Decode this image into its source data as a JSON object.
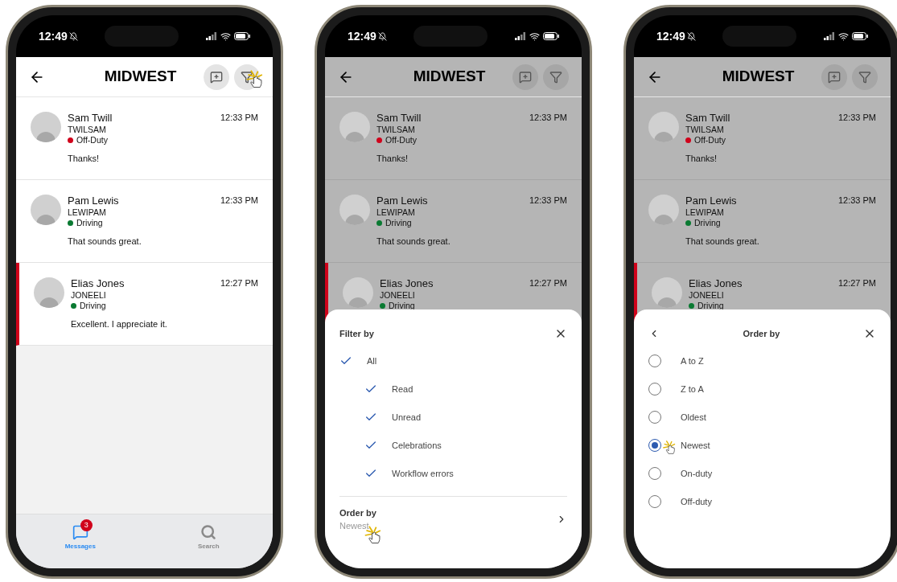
{
  "phones": [
    {
      "status_time": "12:49",
      "title": "MIDWEST",
      "dimmed": false,
      "header_buttons": [
        {
          "kind": "new-message",
          "tap": false
        },
        {
          "kind": "filter",
          "tap": true
        }
      ],
      "messages": [
        {
          "name": "Sam Twill",
          "user_id": "TWILSAM",
          "status": "Off-Duty",
          "color": "#d0021b",
          "text": "Thanks!",
          "time": "12:33 PM",
          "flagged": false
        },
        {
          "name": "Pam Lewis",
          "user_id": "LEWIPAM",
          "status": "Driving",
          "color": "#0a7a32",
          "text": "That sounds great.",
          "time": "12:33 PM",
          "flagged": false
        },
        {
          "name": "Elias Jones",
          "user_id": "JONEELI",
          "status": "Driving",
          "color": "#0a7a32",
          "text": "Excellent. I appreciate it.",
          "time": "12:27 PM",
          "flagged": true
        }
      ],
      "tab_bar": [
        {
          "kind": "messages",
          "label": "Messages",
          "selected": true,
          "badge": "3"
        },
        {
          "kind": "search",
          "label": "Search",
          "selected": false
        }
      ]
    },
    {
      "status_time": "12:49",
      "title": "MIDWEST",
      "dimmed": true,
      "header_buttons": [
        {
          "kind": "new-message",
          "tap": false
        },
        {
          "kind": "filter",
          "tap": false
        }
      ],
      "messages": [
        {
          "name": "Sam Twill",
          "user_id": "TWILSAM",
          "status": "Off-Duty",
          "color": "#d0021b",
          "text": "Thanks!",
          "time": "12:33 PM",
          "flagged": false
        },
        {
          "name": "Pam Lewis",
          "user_id": "LEWIPAM",
          "status": "Driving",
          "color": "#0a7a32",
          "text": "That sounds great.",
          "time": "12:33 PM",
          "flagged": false
        },
        {
          "name": "Elias Jones",
          "user_id": "JONEELI",
          "status": "Driving",
          "color": "#0a7a32",
          "time": "12:27 PM",
          "flagged": true
        }
      ],
      "sheet": {
        "kind": "filter",
        "title": "Filter by",
        "options": [
          {
            "label": "All",
            "checked": true,
            "children": [
              {
                "label": "Read",
                "checked": true
              },
              {
                "label": "Unread",
                "checked": true
              },
              {
                "label": "Celebrations",
                "checked": true
              },
              {
                "label": "Workflow errors",
                "checked": true
              }
            ]
          }
        ],
        "order_row": {
          "label": "Order by",
          "value": "Newest",
          "tap": true
        }
      }
    },
    {
      "status_time": "12:49",
      "title": "MIDWEST",
      "dimmed": true,
      "header_buttons": [
        {
          "kind": "new-message",
          "tap": false
        },
        {
          "kind": "filter",
          "tap": false
        }
      ],
      "messages": [
        {
          "name": "Sam Twill",
          "user_id": "TWILSAM",
          "status": "Off-Duty",
          "color": "#d0021b",
          "text": "Thanks!",
          "time": "12:33 PM",
          "flagged": false
        },
        {
          "name": "Pam Lewis",
          "user_id": "LEWIPAM",
          "status": "Driving",
          "color": "#0a7a32",
          "text": "That sounds great.",
          "time": "12:33 PM",
          "flagged": false
        },
        {
          "name": "Elias Jones",
          "user_id": "JONEELI",
          "status": "Driving",
          "color": "#0a7a32",
          "time": "12:27 PM",
          "flagged": true
        }
      ],
      "sheet": {
        "kind": "order",
        "title": "Order by",
        "options": [
          {
            "label": "A to Z",
            "selected": false,
            "tap": false
          },
          {
            "label": "Z to A",
            "selected": false,
            "tap": false
          },
          {
            "label": "Oldest",
            "selected": false,
            "tap": false
          },
          {
            "label": "Newest",
            "selected": true,
            "tap": true
          },
          {
            "label": "On-duty",
            "selected": false,
            "tap": false
          },
          {
            "label": "Off-duty",
            "selected": false,
            "tap": false
          }
        ]
      }
    }
  ]
}
